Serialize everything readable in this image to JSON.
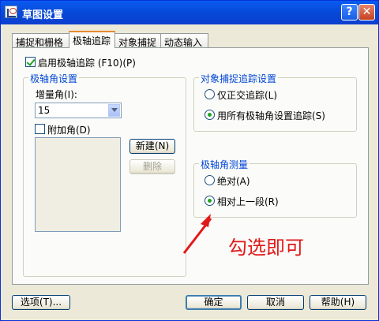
{
  "window": {
    "title": "草图设置",
    "help_label": "?",
    "close_label": "✕"
  },
  "tabs": [
    {
      "label": "捕捉和栅格"
    },
    {
      "label": "极轴追踪"
    },
    {
      "label": "对象捕捉"
    },
    {
      "label": "动态输入"
    }
  ],
  "polar": {
    "enable_label": "启用极轴追踪 (F10)(P)",
    "enable_checked": true,
    "angle_group": {
      "title": "极轴角设置",
      "increment_label": "增量角(I):",
      "increment_value": "15",
      "additional_label": "附加角(D)",
      "additional_checked": false,
      "new_button": "新建(N)",
      "delete_button": "删除"
    },
    "snap_group": {
      "title": "对象捕捉追踪设置",
      "orthogonal_label": "仅正交追踪(L)",
      "all_label": "用所有极轴角设置追踪(S)",
      "selected": "all"
    },
    "measure_group": {
      "title": "极轴角测量",
      "absolute_label": "绝对(A)",
      "relative_label": "相对上一段(R)",
      "selected": "relative"
    }
  },
  "footer": {
    "options_button": "选项(T)...",
    "ok_button": "确定",
    "cancel_button": "取消",
    "help_button": "帮助(H)"
  },
  "annotation": {
    "text": "勾选即可",
    "color": "#e01a1a"
  },
  "colors": {
    "accent": "#0046d5",
    "titlebar": "#0a5bf0"
  }
}
